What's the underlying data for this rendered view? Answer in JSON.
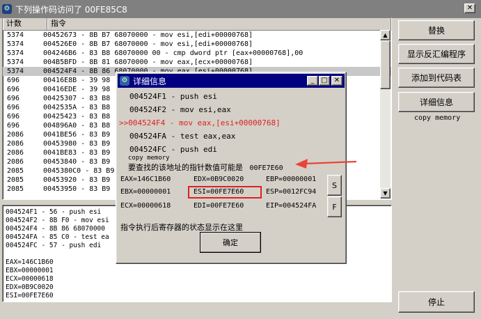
{
  "window": {
    "title": "下列操作码访问了 00FE85C8",
    "close_glyph": "✕"
  },
  "list": {
    "headers": [
      "计数",
      "指令"
    ],
    "rows": [
      {
        "count": "5374",
        "instr": "00452673 - 8B B7 68070000  - mov esi,[edi+00000768]"
      },
      {
        "count": "5374",
        "instr": "004526E0 - 8B B7 68070000  - mov esi,[edi+00000768]"
      },
      {
        "count": "5374",
        "instr": "004246B6 - 83 B8 68070000 00 - cmp dword ptr [eax+00000768],00"
      },
      {
        "count": "5374",
        "instr": "004B5BFD - 8B 81 68070000  - mov eax,[ecx+00000768]"
      },
      {
        "count": "5374",
        "instr": "004524F4 - 8B 86 68070000  - mov eax,[esi+00000768]"
      },
      {
        "count": "696",
        "instr": "00416E8B - 39 98"
      },
      {
        "count": "696",
        "instr": "00416EDE - 39 98"
      },
      {
        "count": "696",
        "instr": "00425307 - 83 B8"
      },
      {
        "count": "696",
        "instr": "0042535A - 83 B8"
      },
      {
        "count": "696",
        "instr": "00425423 - 83 B8"
      },
      {
        "count": "696",
        "instr": "004896A0 - 83 B8"
      },
      {
        "count": "2086",
        "instr": "0041BE56 - 83 B9"
      },
      {
        "count": "2086",
        "instr": "00453980 - 83 B9"
      },
      {
        "count": "2086",
        "instr": "0041BE83 - 83 B9"
      },
      {
        "count": "2086",
        "instr": "00453840 - 83 B9"
      },
      {
        "count": "2085",
        "instr": "0045380C0 - 83 B9"
      },
      {
        "count": "2085",
        "instr": "00453920 - 83 B9"
      },
      {
        "count": "2085",
        "instr": "00453950 - 83 B9"
      }
    ]
  },
  "lower": {
    "lines": [
      "004524F1 - 56 - push esi",
      "004524F2 - 8B F0  - mov esi",
      "004524F4 - 8B 86 68070000",
      "004524FA - 85 C0  - test ea",
      "004524FC - 57 - push edi",
      "",
      "EAX=146C1B60",
      "EBX=00000001",
      "ECX=00000618",
      "EDX=0B9C0020",
      "ESI=00FE7E60"
    ]
  },
  "buttons": {
    "replace": "替换",
    "disasm": "显示反汇编程序",
    "add_code": "添加到代码表",
    "detail": "详细信息",
    "copy_memory": "copy memory",
    "stop": "停止"
  },
  "dialog": {
    "title": "详细信息",
    "lines": [
      {
        "text": "004524F1 - push esi",
        "highlight": false
      },
      {
        "text": "004524F2 - mov esi,eax",
        "highlight": false
      },
      {
        "text": ">>004524F4 - mov eax,[esi+00000768]",
        "highlight": true
      },
      {
        "text": "004524FA - test eax,eax",
        "highlight": false
      },
      {
        "text": "004524FC - push edi",
        "highlight": false
      }
    ],
    "copy_memory": "copy memory",
    "pointer_note": "要查找的该地址的指针数值可能是",
    "pointer_value": "00FE7E60",
    "registers": {
      "eax": "EAX=146C1B60",
      "edx": "EDX=0B9C0020",
      "ebp": "EBP=00000001",
      "ebx": "EBX=00000001",
      "esi": "ESI=00FE7E60",
      "esp": "ESP=0012FC94",
      "ecx": "ECX=00000618",
      "edi": "EDI=00FE7E60",
      "eip": "EIP=004524FA"
    },
    "s_button": "S",
    "f_button": "F",
    "note": "指令执行后寄存器的状态显示在这里",
    "ok": "确定",
    "colors": {
      "highlight": "#e02020",
      "arrow": "#e8453a",
      "box": "#e02020"
    }
  }
}
